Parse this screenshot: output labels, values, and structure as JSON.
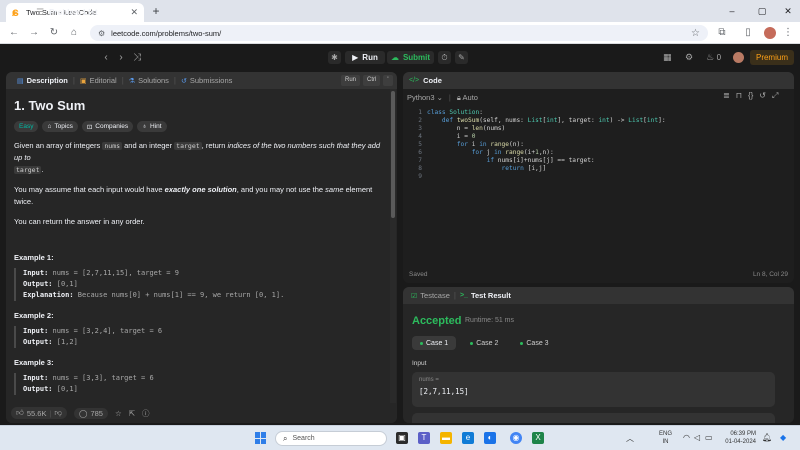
{
  "browser": {
    "tab_title": "Two Sum - LeetCode",
    "url": "leetcode.com/problems/two-sum/"
  },
  "navbar": {
    "problem_list": "Problem List",
    "run": "Run",
    "submit": "Submit",
    "streak": "0",
    "premium": "Premium"
  },
  "left_tabs": [
    {
      "label": "Description",
      "icon": "document-icon"
    },
    {
      "label": "Editorial",
      "icon": "book-icon"
    },
    {
      "label": "Solutions",
      "icon": "flask-icon"
    },
    {
      "label": "Submissions",
      "icon": "history-icon"
    }
  ],
  "run_shortcut": {
    "run": "Run",
    "ctrl": "Ctrl",
    "key": "'"
  },
  "problem": {
    "title": "1. Two Sum",
    "chips": [
      "Easy",
      "Topics",
      "Companies",
      "Hint"
    ],
    "desc_1a": "Given an array of integers ",
    "desc_1_nums": "nums",
    "desc_1b": " and an integer ",
    "desc_1_target": "target",
    "desc_1c": ", return ",
    "desc_1_em": "indices of the two numbers such that they add up to",
    "desc_1_target2": "target",
    "desc_1d": ".",
    "desc_2a": "You may assume that each input would have ",
    "desc_2_bold": "exactly one solution",
    "desc_2b": ", and you may not use the ",
    "desc_2_em": "same",
    "desc_2c": " element twice.",
    "desc_3": "You can return the answer in any order."
  },
  "examples": [
    {
      "heading": "Example 1:",
      "input_label": "Input:",
      "input": "nums = [2,7,11,15], target = 9",
      "output_label": "Output:",
      "output": "[0,1]",
      "expl_label": "Explanation:",
      "expl": "Because nums[0] + nums[1] == 9, we return [0, 1]."
    },
    {
      "heading": "Example 2:",
      "input_label": "Input:",
      "input": "nums = [3,2,4], target = 6",
      "output_label": "Output:",
      "output": "[1,2]"
    },
    {
      "heading": "Example 3:",
      "input_label": "Input:",
      "input": "nums = [3,3], target = 6",
      "output_label": "Output:",
      "output": "[0,1]"
    }
  ],
  "footer": {
    "likes": "55.6K",
    "comments": "785"
  },
  "code": {
    "tab": "Code",
    "language": "Python3",
    "mode": "Auto",
    "status": "Saved",
    "position": "Ln 8, Col 29",
    "line_numbers": [
      "1",
      "2",
      "3",
      "4",
      "5",
      "6",
      "7",
      "8",
      "9"
    ]
  },
  "test": {
    "tabs": [
      "Testcase",
      "Test Result"
    ],
    "verdict": "Accepted",
    "runtime": "Runtime: 51 ms",
    "cases": [
      "Case 1",
      "Case 2",
      "Case 3"
    ],
    "input_label": "Input",
    "var_name": "nums =",
    "var_value": "[2,7,11,15]"
  },
  "taskbar": {
    "search": "Search",
    "lang_1": "ENG",
    "lang_2": "IN",
    "time": "06:39 PM",
    "date": "01-04-2024"
  }
}
